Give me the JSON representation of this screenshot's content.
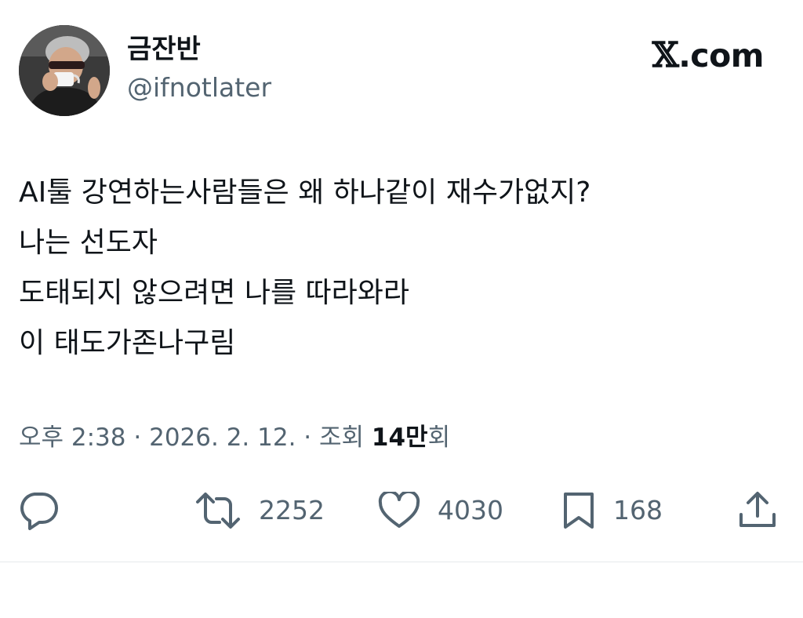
{
  "user": {
    "display_name": "금잔반",
    "handle": "@ifnotlater",
    "avatar_icon": "avatar-photo"
  },
  "brand": {
    "x_glyph": "𝕏",
    "text": ".com"
  },
  "tweet": {
    "lines": [
      "AI툴 강연하는사람들은 왜 하나같이 재수가없지?",
      "나는 선도자",
      "도태되지 않으려면 나를 따라와라",
      "이 태도가존나구림"
    ]
  },
  "meta": {
    "time": "오후 2:38",
    "separator": "·",
    "date": "2026. 2. 12.",
    "views_label": "조회",
    "views_count": "14만",
    "views_suffix": "회"
  },
  "actions": {
    "reply": {
      "icon": "reply-icon"
    },
    "retweet": {
      "icon": "retweet-icon",
      "count": "2252"
    },
    "like": {
      "icon": "heart-icon",
      "count": "4030"
    },
    "bookmark": {
      "icon": "bookmark-icon",
      "count": "168"
    },
    "share": {
      "icon": "share-icon"
    }
  },
  "colors": {
    "text_primary": "#0f1419",
    "text_secondary": "#536471",
    "divider": "#e6e9eb"
  }
}
